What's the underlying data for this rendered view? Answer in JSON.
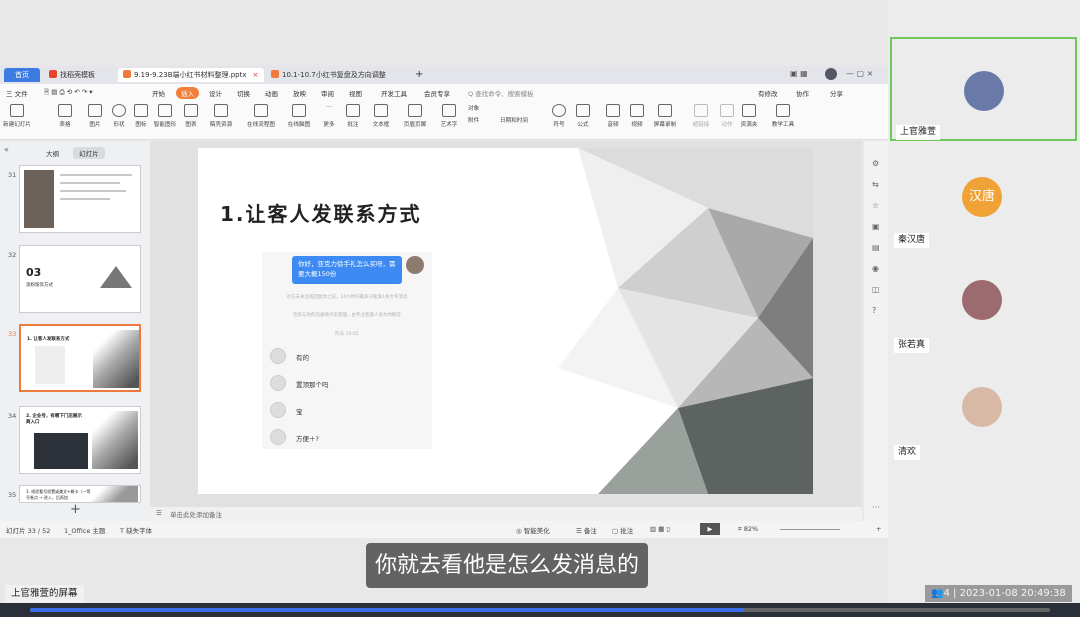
{
  "tabs": {
    "home": "首页",
    "docer": "找稻壳模板",
    "file_active": "9.19-9.23B端小红书材料整理.pptx",
    "file_2": "10.1-10.7小红书复盘及方向调整",
    "new_tab": "+",
    "close": "×"
  },
  "menu": {
    "file": "三 文件",
    "items": [
      "开始",
      "插入",
      "设计",
      "切换",
      "动画",
      "放映",
      "审阅",
      "视图",
      "开发工具",
      "会员专享"
    ],
    "active": "插入",
    "search": "Q 查找命令、搜索模板",
    "right": [
      "有修改",
      "协作",
      "分享"
    ]
  },
  "ribbon": [
    "新建幻灯片",
    "表格",
    "图片",
    "形状",
    "图标",
    "智能图形",
    "图表",
    "稿壳资源",
    "在线流程图",
    "在线脑图",
    "更多",
    "批注",
    "文本框",
    "页眉页脚",
    "艺术字",
    "对象",
    "附件",
    "日期和时间",
    "符号",
    "公式",
    "音频",
    "视频",
    "屏幕录制",
    "超链接",
    "动作",
    "资源夹",
    "教学工具"
  ],
  "left_panel": {
    "tab_outline": "大纲",
    "tab_slides": "幻灯片",
    "thumbs": [
      {
        "num": "31",
        "text": ""
      },
      {
        "num": "32",
        "text": "03",
        "sub": "涨粉留资方式"
      },
      {
        "num": "33",
        "text": "1. 让客人发联系方式"
      },
      {
        "num": "34",
        "text": "2. 企业号，有哪下门店展示商入口"
      },
      {
        "num": "35",
        "text": "3. 线验看号投置或美文+概卡（一等号卷点 → 进入，后再加"
      }
    ],
    "add": "+"
  },
  "slide": {
    "title": "1.让客人发联系方式",
    "chat_me": "你好，亚克力徐手礼怎么买呀，需要大概150份",
    "tip1": "对方未关注或回复你之前，24小时内最多只能发1条文字消息",
    "tip2": "连续与你的沟通请点击管理，由专业客服人员为你解答",
    "time": "昨天 19:05",
    "replies": [
      "有的",
      "置顶那个吗",
      "宝",
      "方便＋?"
    ]
  },
  "notes": "单击此处添加备注",
  "status": {
    "slide": "幻灯片 33 / 52",
    "theme": "1_Office 主题",
    "font": "缺失字体",
    "beautify": "智能美化",
    "remark": "备注",
    "comment": "批注",
    "zoom": "82%"
  },
  "subtitle": "你就去看他是怎么发消息的",
  "presenter_label": "上官雅萱的屏幕",
  "participants": [
    {
      "name": "上官雅萱",
      "active": true,
      "color": "#6a7aa8"
    },
    {
      "name": "秦汉唐",
      "active": false,
      "color": "#f0a236",
      "initials": "汉唐"
    },
    {
      "name": "张若真",
      "active": false,
      "color": "#9b6b70"
    },
    {
      "name": "清欢",
      "active": false,
      "color": "#d8b9a6"
    }
  ],
  "info": {
    "count": "4",
    "datetime": "2023-01-08 20:49:38"
  },
  "progress": 0.7
}
